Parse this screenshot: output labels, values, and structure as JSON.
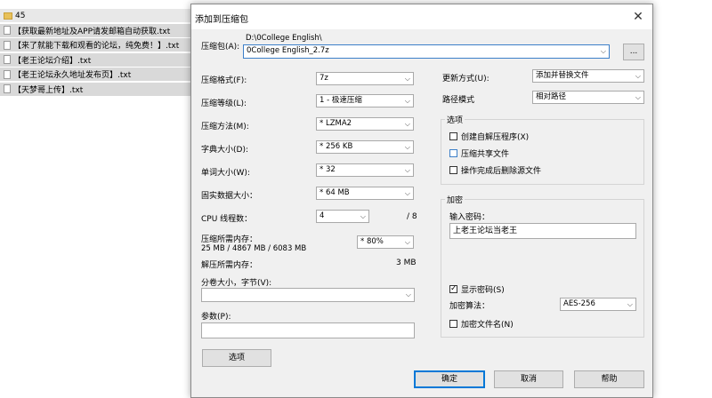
{
  "explorer": {
    "folder": "45",
    "files": [
      "【获取最新地址及APP请发邮箱自动获取.txt",
      "【来了就能下载和观看的论坛，纯免费！】.txt",
      "【老王论坛介绍】.txt",
      "【老王论坛永久地址发布页】.txt",
      "【天梦哥上传】.txt"
    ]
  },
  "dialog": {
    "title": "添加到压缩包",
    "close_glyph": "✕",
    "archive_label": "压缩包(A):",
    "archive_path": "D:\\0College English\\",
    "archive_name": "0College English_2.7z",
    "browse_label": "...",
    "format_label": "压缩格式(F):",
    "format_value": "7z",
    "level_label": "压缩等级(L):",
    "level_value": "1 - 极速压缩",
    "method_label": "压缩方法(M):",
    "method_value": "* LZMA2",
    "dict_label": "字典大小(D):",
    "dict_value": "* 256 KB",
    "word_label": "单词大小(W):",
    "word_value": "* 32",
    "solid_label": "固实数据大小：",
    "solid_value": "* 64 MB",
    "cpu_label": "CPU 线程数：",
    "cpu_value": "4",
    "cpu_total": "/ 8",
    "mem_comp_label": "压缩所需内存：",
    "mem_comp_value": "25 MB / 4867 MB / 6083 MB",
    "mem_pct_value": "* 80%",
    "mem_decomp_label": "解压所需内存：",
    "mem_decomp_value": "3 MB",
    "split_label": "分卷大小，字节(V):",
    "split_value": "",
    "params_label": "参数(P):",
    "params_value": "",
    "options_button": "选项",
    "update_label": "更新方式(U):",
    "update_value": "添加并替换文件",
    "path_label": "路径模式",
    "path_value": "相对路径",
    "options_group": "选项",
    "opt_sfx": "创建自解压程序(X)",
    "opt_shared": "压缩共享文件",
    "opt_delete": "操作完成后删除源文件",
    "encrypt_group": "加密",
    "password_label": "输入密码：",
    "password_value": "上老王论坛当老王",
    "show_password": "显示密码(S)",
    "enc_method_label": "加密算法：",
    "enc_method_value": "AES-256",
    "encrypt_names": "加密文件名(N)",
    "ok_button": "确定",
    "cancel_button": "取消",
    "help_button": "帮助",
    "dropdown_glyph": "⌵",
    "check_glyph": "✓"
  }
}
